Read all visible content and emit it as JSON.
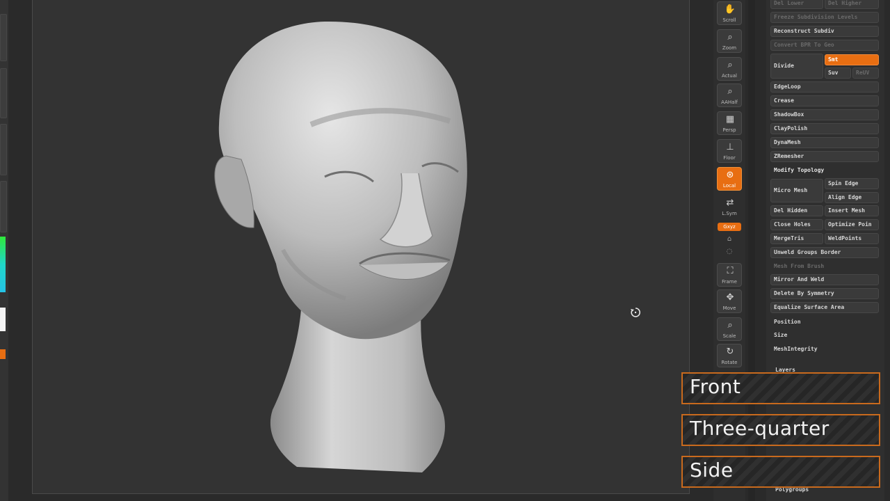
{
  "colors": {
    "accent": "#e86e12",
    "label_border": "#c96a1d",
    "viewport_bg": "#333333"
  },
  "shelf": {
    "buttons": [
      {
        "name": "scroll",
        "label": "Scroll",
        "icon": "hand-icon"
      },
      {
        "name": "zoom",
        "label": "Zoom",
        "icon": "zoom-icon"
      },
      {
        "name": "actual",
        "label": "Actual",
        "icon": "zoom-icon"
      },
      {
        "name": "aahalf",
        "label": "AAHalf",
        "icon": "zoom-icon"
      },
      {
        "name": "persp",
        "label": "Persp",
        "icon": "persp-icon"
      },
      {
        "name": "floor",
        "label": "Floor",
        "icon": "floor-icon"
      },
      {
        "name": "local",
        "label": "Local",
        "icon": "local-icon"
      },
      {
        "name": "lsym",
        "label": "L.Sym",
        "icon": "lsym-icon"
      },
      {
        "name": "frame",
        "label": "Frame",
        "icon": "frame-icon"
      },
      {
        "name": "move",
        "label": "Move",
        "icon": "move-icon"
      },
      {
        "name": "scale",
        "label": "Scale",
        "icon": "scale-icon"
      },
      {
        "name": "rotate",
        "label": "Rotate",
        "icon": "rotate-icon"
      }
    ],
    "xyz_label": "Gxyz"
  },
  "panel": {
    "top_dim_1": "Del Lower",
    "top_dim_2": "Del Higher",
    "freeze_label": "Freeze Subdivision Levels",
    "reconstruct": "Reconstruct Subdiv",
    "convert_bpr": "Convert BPR To Geo",
    "divide": "Divide",
    "smt": "Smt",
    "suv": "Suv",
    "reuv": "ReUV",
    "edgeloop": "EdgeLoop",
    "crease": "Crease",
    "shadowbox": "ShadowBox",
    "claypolish": "ClayPolish",
    "dynamesh": "DynaMesh",
    "zremesher": "ZRemesher",
    "modify_topology": "Modify Topology",
    "micro_mesh": "Micro Mesh",
    "spin_edge": "Spin Edge",
    "align_edge": "Align Edge",
    "del_hidden": "Del Hidden",
    "insert_mesh": "Insert Mesh",
    "close_holes": "Close Holes",
    "optimize_points": "Optimize Poin",
    "mergetris": "MergeTris",
    "weldpoints": "WeldPoints",
    "unweld_groups": "Unweld Groups Border",
    "mesh_from_brush": "Mesh From Brush",
    "mirror_weld": "Mirror And Weld",
    "delete_symmetry": "Delete By Symmetry",
    "equalize": "Equalize Surface Area",
    "position": "Position",
    "size": "Size",
    "meshintegrity": "MeshIntegrity",
    "layers": "Layers",
    "polygroups": "Polygroups"
  },
  "labels": {
    "front": "Front",
    "three_quarter": "Three-quarter",
    "side": "Side"
  }
}
